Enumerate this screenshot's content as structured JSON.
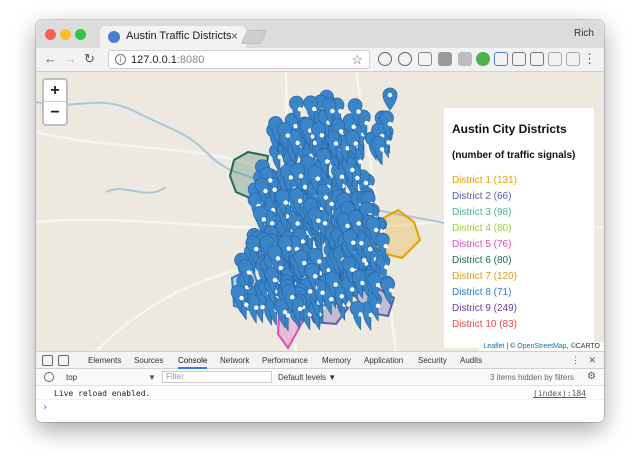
{
  "browser": {
    "tab_title": "Austin Traffic Districts",
    "profile_name": "Rich",
    "url_host": "127.0.0.1",
    "url_port": ":8080"
  },
  "map": {
    "legend": {
      "title": "Austin City Districts",
      "subtitle": "(number of traffic signals)",
      "items": [
        {
          "label": "District 1 (131)",
          "color": "#e69f00"
        },
        {
          "label": "District 2 (66)",
          "color": "#5a5eaa"
        },
        {
          "label": "District 3 (98)",
          "color": "#3db89a"
        },
        {
          "label": "District 4 (80)",
          "color": "#9ccc3a"
        },
        {
          "label": "District 5 (76)",
          "color": "#d94fbf"
        },
        {
          "label": "District 6 (80)",
          "color": "#1f6b55"
        },
        {
          "label": "District 7 (120)",
          "color": "#d69b1a"
        },
        {
          "label": "District 8 (71)",
          "color": "#2b80c8"
        },
        {
          "label": "District 9 (249)",
          "color": "#6a3d9a"
        },
        {
          "label": "District 10 (83)",
          "color": "#e84a4a"
        }
      ]
    },
    "zoom_in": "+",
    "zoom_out": "−",
    "attribution": {
      "leaflet": "Leaflet",
      "sep1": " | © ",
      "osm": "OpenStreetMap",
      "sep2": ", ©CARTO"
    },
    "marker_color": "#3a85c8"
  },
  "devtools": {
    "tabs": [
      "Elements",
      "Sources",
      "Console",
      "Network",
      "Performance",
      "Memory",
      "Application",
      "Security",
      "Audits"
    ],
    "active_tab": "Console",
    "context": "top",
    "filter_placeholder": "Filter",
    "levels": "Default levels ▼",
    "hidden_count": "3 items hidden by filters",
    "console_message": "Live reload enabled.",
    "console_source": "(index):184",
    "prompt": "›"
  }
}
